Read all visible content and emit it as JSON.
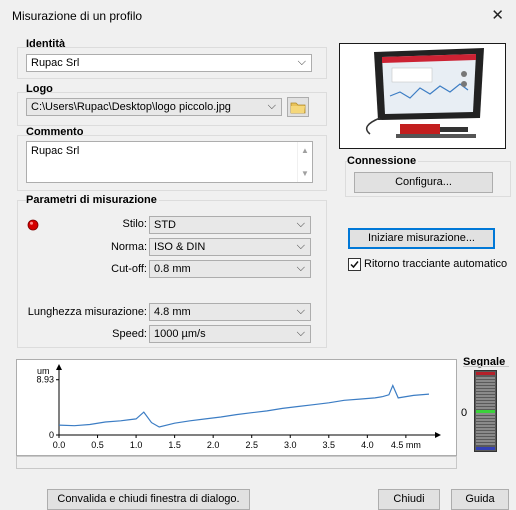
{
  "window": {
    "title": "Misurazione di un profilo",
    "close_icon": "close-icon"
  },
  "identita": {
    "label": "Identità",
    "value": "Rupac Srl"
  },
  "logo": {
    "label": "Logo",
    "value": "C:\\Users\\Rupac\\Desktop\\logo piccolo.jpg",
    "browse_icon": "folder-icon"
  },
  "commento": {
    "label": "Commento",
    "value": "Rupac Srl"
  },
  "connessione": {
    "label": "Connessione",
    "configure_label": "Configura..."
  },
  "parametri": {
    "label": "Parametri di misurazione",
    "status_color": "#d40000",
    "stilo": {
      "label": "Stilo:",
      "value": "STD"
    },
    "norma": {
      "label": "Norma:",
      "value": "ISO & DIN"
    },
    "cutoff": {
      "label": "Cut-off:",
      "value": "0.8 mm"
    },
    "lunghezza": {
      "label": "Lunghezza misurazione:",
      "value": "4.8 mm"
    },
    "speed": {
      "label": "Speed:",
      "value": "1000 µm/s"
    }
  },
  "actions": {
    "start_label": "Iniziare misurazione...",
    "auto_return_label": "Ritorno tracciante automatico",
    "auto_return_checked": true
  },
  "segnale": {
    "label": "Segnale",
    "zero_label": "0",
    "level": 0.5
  },
  "footer": {
    "validate_label": "Convalida e chiudi finestra di dialogo.",
    "close_label": "Chiudi",
    "help_label": "Guida"
  },
  "chart_data": {
    "type": "line",
    "ylabel": "um",
    "y_ticks": [
      "8.93",
      "0"
    ],
    "y_tick_values": [
      8.93,
      0
    ],
    "x_ticks": [
      "0.0",
      "0.5",
      "1.0",
      "1.5",
      "2.0",
      "2.5",
      "3.0",
      "3.5",
      "4.0",
      "4.5 mm"
    ],
    "x_tick_values": [
      0,
      0.5,
      1.0,
      1.5,
      2.0,
      2.5,
      3.0,
      3.5,
      4.0,
      4.5
    ],
    "xlim": [
      0,
      4.8
    ],
    "ylim": [
      0,
      10.5
    ],
    "series": [
      {
        "color": "#3c7dc4",
        "x": [
          0.0,
          0.2,
          0.4,
          0.6,
          0.8,
          1.0,
          1.1,
          1.2,
          1.3,
          1.5,
          1.7,
          1.9,
          2.1,
          2.3,
          2.5,
          2.7,
          2.9,
          3.1,
          3.3,
          3.5,
          3.7,
          3.9,
          4.1,
          4.2,
          4.28,
          4.33,
          4.4,
          4.6,
          4.8
        ],
        "y": [
          1.6,
          1.5,
          1.7,
          2.1,
          2.3,
          2.6,
          3.7,
          2.0,
          1.3,
          1.9,
          2.3,
          2.6,
          2.9,
          3.3,
          3.6,
          3.9,
          4.3,
          4.6,
          4.9,
          5.2,
          5.6,
          5.8,
          6.0,
          6.2,
          6.5,
          8.0,
          6.0,
          6.4,
          6.6
        ]
      }
    ]
  }
}
